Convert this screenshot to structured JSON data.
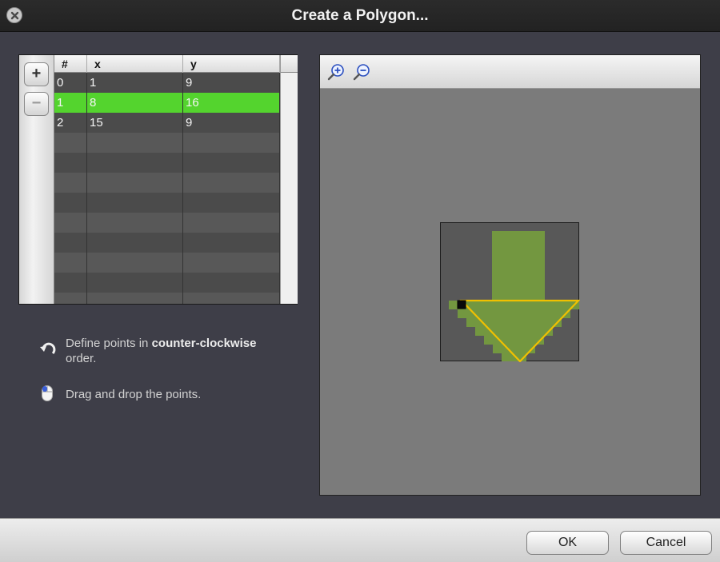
{
  "dialog": {
    "title": "Create a Polygon..."
  },
  "table": {
    "add_label": "+",
    "remove_label": "−",
    "columns": [
      "#",
      "x",
      "y"
    ],
    "rows": [
      {
        "index": "0",
        "x": "1",
        "y": "9"
      },
      {
        "index": "1",
        "x": "8",
        "y": "16"
      },
      {
        "index": "2",
        "x": "15",
        "y": "9"
      }
    ],
    "selected_row": 1
  },
  "hints": {
    "order_prefix": "Define points in",
    "order_bold": "counter-clockwise",
    "order_suffix": "order.",
    "drag": "Drag and drop the points."
  },
  "preview": {
    "zoom_in_icon": "zoom-in-icon",
    "zoom_out_icon": "zoom-out-icon",
    "polygon_points": [
      [
        1,
        9
      ],
      [
        8,
        16
      ],
      [
        15,
        9
      ]
    ]
  },
  "footer": {
    "ok": "OK",
    "cancel": "Cancel"
  },
  "colors": {
    "selection": "#54d42e",
    "polygon_outline": "#f0c000",
    "sprite_fill": "#739740"
  }
}
